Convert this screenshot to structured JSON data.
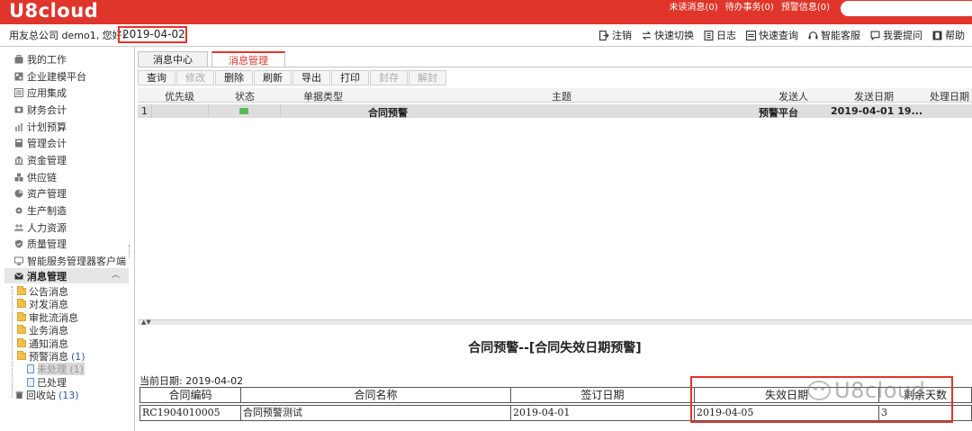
{
  "app": {
    "logo": "U8cloud"
  },
  "top_links": [
    "未读消息(0)",
    "待办事务(0)",
    "预警信息(0)"
  ],
  "user": {
    "greeting": "用友总公司 demo1, 您好!",
    "date": "2019-04-02"
  },
  "toolbar_links": [
    {
      "label": "注销",
      "icon": "logout-icon"
    },
    {
      "label": "快速切换",
      "icon": "switch-icon"
    },
    {
      "label": "日志",
      "icon": "log-icon"
    },
    {
      "label": "快速查询",
      "icon": "query-icon"
    },
    {
      "label": "智能客服",
      "icon": "service-icon"
    },
    {
      "label": "我要提问",
      "icon": "question-icon"
    },
    {
      "label": "帮助",
      "icon": "help-icon"
    }
  ],
  "sidebar": {
    "items": [
      "我的工作",
      "企业建模平台",
      "应用集成",
      "财务会计",
      "计划预算",
      "管理会计",
      "资金管理",
      "供应链",
      "资产管理",
      "生产制造",
      "人力资源",
      "质量管理",
      "智能服务管理器客户端"
    ],
    "active": "消息管理",
    "sub_items": [
      {
        "label": "公告消息",
        "count": ""
      },
      {
        "label": "对发消息",
        "count": ""
      },
      {
        "label": "审批流消息",
        "count": ""
      },
      {
        "label": "业务消息",
        "count": ""
      },
      {
        "label": "通知消息",
        "count": ""
      },
      {
        "label": "预警消息",
        "count": "(1)"
      }
    ],
    "warn_children": [
      "未处理 (1)",
      "已处理"
    ],
    "recycle": {
      "label": "回收站",
      "count": "(13)"
    }
  },
  "tabs": [
    "消息中心",
    "消息管理"
  ],
  "actions": [
    {
      "label": "查询",
      "enabled": true
    },
    {
      "label": "修改",
      "enabled": false
    },
    {
      "label": "删除",
      "enabled": true
    },
    {
      "label": "刷新",
      "enabled": true
    },
    {
      "label": "导出",
      "enabled": true
    },
    {
      "label": "打印",
      "enabled": true
    },
    {
      "label": "封存",
      "enabled": false
    },
    {
      "label": "解封",
      "enabled": false
    }
  ],
  "grid": {
    "columns": [
      "优先级",
      "状态",
      "单据类型",
      "主题",
      "发送人",
      "发送日期",
      "处理日期"
    ],
    "rows": [
      {
        "no": "1",
        "status_icon": "mail-icon",
        "subject": "合同预警",
        "sender": "预警平台",
        "send_date": "2019-04-01 19..."
      }
    ]
  },
  "detail": {
    "title": "合同预警--[合同失效日期预警]",
    "current_date_label": "当前日期:",
    "current_date": "2019-04-02",
    "columns": [
      "合同编码",
      "合同名称",
      "签订日期",
      "失效日期",
      "剩余天数"
    ],
    "rows": [
      [
        "RC1904010005",
        "合同预警测试",
        "2019-04-01",
        "2019-04-05",
        "3"
      ]
    ]
  },
  "watermark": "U8cloud",
  "colors": {
    "brand": "#e0352b",
    "accent_blue": "#3355aa"
  }
}
